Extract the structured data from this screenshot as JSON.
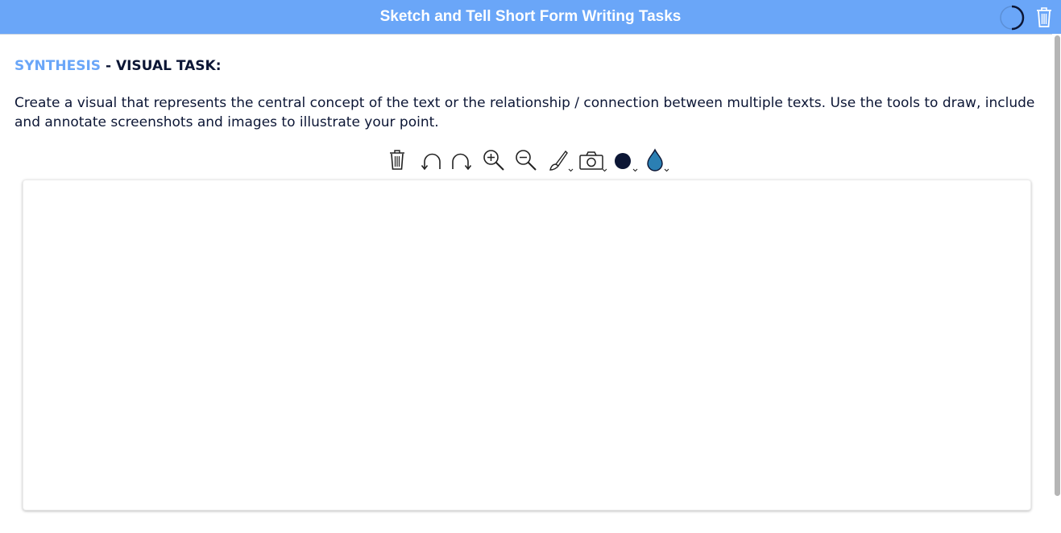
{
  "header": {
    "title": "Sketch and Tell Short Form Writing Tasks",
    "background_color": "#6aa6f8",
    "spinner_icon": "loading-spinner-icon",
    "delete_icon": "trash-icon"
  },
  "task": {
    "category": "SYNTHESIS",
    "separator": " - ",
    "type": "VISUAL TASK:",
    "accent_color": "#6aa6f8",
    "instructions": "Create a visual that represents the central concept of the text or the relationship / connection between multiple texts. Use the tools to draw, include and annotate screenshots and images to illustrate your point."
  },
  "toolbar": {
    "tools": [
      {
        "name": "clear-canvas",
        "icon": "trash-icon"
      },
      {
        "name": "undo",
        "icon": "undo-icon"
      },
      {
        "name": "redo",
        "icon": "redo-icon"
      },
      {
        "name": "zoom-in",
        "icon": "zoom-in-icon"
      },
      {
        "name": "zoom-out",
        "icon": "zoom-out-icon"
      },
      {
        "name": "brush",
        "icon": "brush-icon",
        "has_dropdown": true
      },
      {
        "name": "screenshot",
        "icon": "camera-icon",
        "has_dropdown": true
      },
      {
        "name": "color",
        "icon": "color-dot-icon",
        "has_dropdown": true,
        "color": "#0c1635"
      },
      {
        "name": "fill",
        "icon": "fill-drop-icon",
        "has_dropdown": true,
        "color": "#2b7fb3"
      }
    ]
  }
}
